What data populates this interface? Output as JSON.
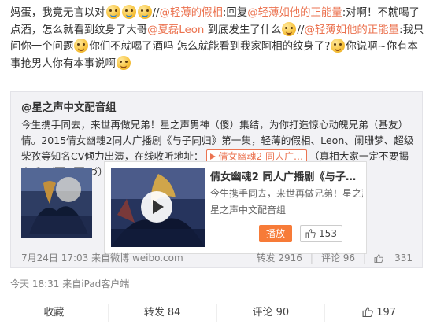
{
  "post": {
    "part1": "妈蛋，我竟无言以对",
    "part2": "//",
    "user1": "@轻薄的假相",
    "part3": ":回复",
    "user2": "@轻薄如他的正能量",
    "part4": ":对啊！不就喝了点酒，怎么就看到纹身了大哥",
    "user3": "@夏磊Leon",
    "part5": " 到底发生了什么",
    "part6": "//",
    "user4": "@轻薄如他的正能量",
    "part7": ":我只问你一个问题",
    "part8": "你们不就喝了酒吗 怎么就能看到我家阿相的纹身了?",
    "part9": "你说啊~你有本事抢男人你有本事说啊"
  },
  "repost": {
    "author": "@星之声中文配音组",
    "text1": "今生携手同去，来世再做兄弟！星之声男神（傻）集结，为你打造惊心动魄兄弟（基友）情。2015倩女幽魂2同人广播剧《与子同归》第一集，轻薄的假相、Leon、阑珊梦、超级柴孜等知名CV倾力出演，在线收听地址：",
    "link": "倩女幽魂2 同人广…",
    "text2": "（真相大家一定不要揭穿哦(づ￣ 3￣)づ）",
    "card_title": "倩女幽魂2 同人广播剧《与子同归》…",
    "card_desc": "今生携手同去，来世再做兄弟！星之声…",
    "card_sub": "星之声中文配音组",
    "play_label": "播放",
    "like_count": "153",
    "time": "7月24日 17:03",
    "source": "来自微博 weibo.com",
    "forward": "转发 2916",
    "comment": "评论 96",
    "likes": "331"
  },
  "meta": {
    "time": "今天 18:31",
    "source": "来自iPad客户端"
  },
  "actions": {
    "fav": "收藏",
    "forward": "转发 84",
    "comment": "评论 90",
    "like": "197"
  },
  "icons": [
    "laugh-cry-emoji",
    "thinking-emoji",
    "sad-emoji",
    "play-icon",
    "thumbs-up-icon"
  ],
  "colors": {
    "link": "#eb7350",
    "play_button": "#f77b38"
  }
}
